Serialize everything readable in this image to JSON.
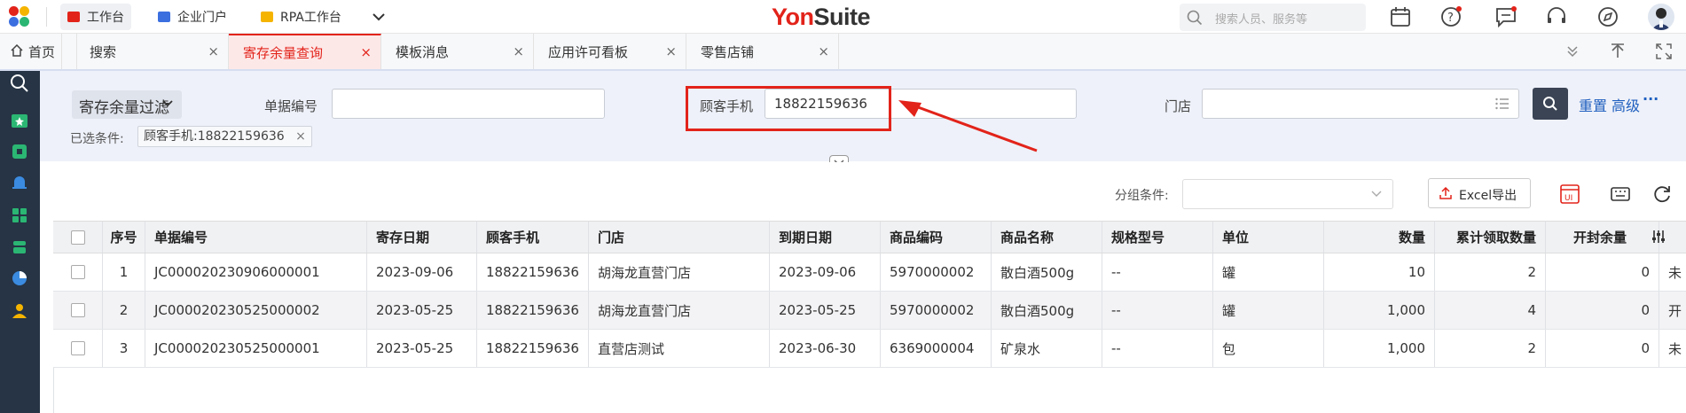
{
  "brand": {
    "part1": "Yon",
    "part2": "Suite"
  },
  "top_tabs": [
    {
      "label": "工作台",
      "color": "#e2231a",
      "active": true
    },
    {
      "label": "企业门户",
      "color": "#3b6fe0",
      "active": false
    },
    {
      "label": "RPA工作台",
      "color": "#f5b400",
      "active": false
    }
  ],
  "search": {
    "placeholder": "搜索人员、服务等"
  },
  "tabs": [
    {
      "label": "首页"
    },
    {
      "label": "搜索"
    },
    {
      "label": "寄存余量查询"
    },
    {
      "label": "模板消息"
    },
    {
      "label": "应用许可看板"
    },
    {
      "label": "零售店铺"
    }
  ],
  "filter": {
    "scheme": "寄存余量过滤",
    "doc_no_label": "单据编号",
    "doc_no_value": "",
    "phone_label": "顾客手机",
    "phone_value": "18822159636",
    "store_label": "门店",
    "store_value": "",
    "reset": "重置",
    "advanced": "高级",
    "more": "···",
    "selected_label": "已选条件:",
    "selected_chip": "顾客手机:18822159636",
    "chip_close": "×"
  },
  "toolbar": {
    "group_label": "分组条件:",
    "group_value": "",
    "excel": "Excel导出"
  },
  "table": {
    "headers": [
      "序号",
      "单据编号",
      "寄存日期",
      "顾客手机",
      "门店",
      "到期日期",
      "商品编码",
      "商品名称",
      "规格型号",
      "单位",
      "数量",
      "累计领取数量",
      "开封余量"
    ],
    "rows": [
      {
        "seq": "1",
        "doc": "JC000020230906000001",
        "date": "2023-09-06",
        "phone": "18822159636",
        "store": "胡海龙直营门店",
        "expire": "2023-09-06",
        "code": "5970000002",
        "name": "散白酒500g",
        "spec": "--",
        "unit": "罐",
        "qty": "10",
        "taken": "2",
        "open": "0",
        "extra": "未"
      },
      {
        "seq": "2",
        "doc": "JC000020230525000002",
        "date": "2023-05-25",
        "phone": "18822159636",
        "store": "胡海龙直营门店",
        "expire": "2023-05-25",
        "code": "5970000002",
        "name": "散白酒500g",
        "spec": "--",
        "unit": "罐",
        "qty": "1,000",
        "taken": "4",
        "open": "0",
        "extra": "开"
      },
      {
        "seq": "3",
        "doc": "JC000020230525000001",
        "date": "2023-05-25",
        "phone": "18822159636",
        "store": "直营店测试",
        "expire": "2023-06-30",
        "code": "6369000004",
        "name": "矿泉水",
        "spec": "--",
        "unit": "包",
        "qty": "1,000",
        "taken": "2",
        "open": "0",
        "extra": "未"
      }
    ]
  },
  "colors": {
    "accent": "#e2231a",
    "link": "#1f5fbf",
    "sidebar": "#263445"
  }
}
